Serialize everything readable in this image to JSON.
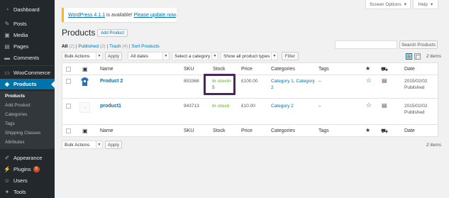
{
  "sidebar": {
    "items": [
      {
        "label": "Dashboard",
        "icon": "dashboard-icon"
      },
      {
        "label": "Posts",
        "icon": "pin-icon"
      },
      {
        "label": "Media",
        "icon": "media-icon"
      },
      {
        "label": "Pages",
        "icon": "page-icon"
      },
      {
        "label": "Comments",
        "icon": "comment-icon"
      },
      {
        "label": "WooCommerce",
        "icon": "woocommerce-icon"
      },
      {
        "label": "Products",
        "icon": "products-icon"
      },
      {
        "label": "Appearance",
        "icon": "brush-icon"
      },
      {
        "label": "Plugins",
        "icon": "plugin-icon",
        "badge": "5"
      },
      {
        "label": "Users",
        "icon": "users-icon"
      },
      {
        "label": "Tools",
        "icon": "wrench-icon"
      }
    ],
    "submenu": [
      "Products",
      "Add Product",
      "Categories",
      "Tags",
      "Shipping Classes",
      "Attributes"
    ]
  },
  "header": {
    "screen_options": "Screen Options",
    "help": "Help",
    "notice_link": "WordPress 4.1.1",
    "notice_text": " is available! ",
    "notice_update": "Please update now",
    "notice_end": ".",
    "title": "Products",
    "add_button": "Add Product"
  },
  "filters": {
    "all": "All",
    "all_count": "(2)",
    "published": "Published",
    "published_count": "(2)",
    "trash": "Trash",
    "trash_count": "(4)",
    "sort": "Sort Products",
    "sep": "|",
    "search_button": "Search Products"
  },
  "toolbar": {
    "bulk_actions": "Bulk Actions",
    "apply": "Apply",
    "all_dates": "All dates",
    "category": "Select a category",
    "product_types": "Show all product types",
    "filter": "Filter",
    "items": "2 items"
  },
  "table": {
    "headers": [
      "Name",
      "SKU",
      "Stock",
      "Price",
      "Categories",
      "Tags",
      "Date"
    ],
    "rows": [
      {
        "name": "Product 2",
        "sku": "853368",
        "stock": "In stock",
        "stock_extra": "×",
        "stock_qty": "5",
        "price": "£100.00",
        "cat1": "Category 1, Category",
        "cat2": "2",
        "tags": "–",
        "date1": "2015/02/02",
        "date2": "Published"
      },
      {
        "name": "product1",
        "sku": "943713",
        "stock": "In stock",
        "price": "£10.00",
        "cat1": "Category 2",
        "tags": "–",
        "date1": "2015/02/02",
        "date2": "Published"
      }
    ]
  },
  "bottom": {
    "bulk_actions": "Bulk Actions",
    "apply": "Apply",
    "items": "2 items"
  },
  "colors": {
    "accent": "#0073aa",
    "sidebar": "#23282d",
    "in_stock": "#7ad03a",
    "highlight": "#4b2560",
    "notice": "#ffba00"
  }
}
